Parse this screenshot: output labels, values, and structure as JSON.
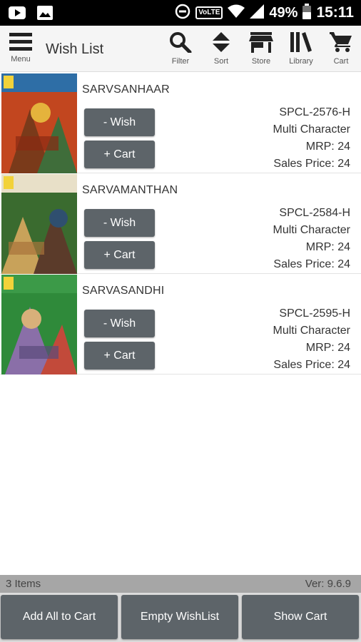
{
  "status_bar": {
    "volte_label": "VoLTE",
    "battery": "49%",
    "time": "15:11"
  },
  "toolbar": {
    "menu_label": "Menu",
    "title": "Wish List",
    "filter_label": "Filter",
    "sort_label": "Sort",
    "store_label": "Store",
    "library_label": "Library",
    "cart_label": "Cart"
  },
  "items": [
    {
      "title": "SARVSANHAAR",
      "wish_label": "- Wish",
      "cart_label": "+ Cart",
      "code": "SPCL-2576-H",
      "category": "Multi Character",
      "mrp": "MRP: 24",
      "sales_price": "Sales Price: 24",
      "cover_colors": [
        "#c2461f",
        "#7a3a1a",
        "#3f6d3a",
        "#e5b33c"
      ]
    },
    {
      "title": "SARVAMANTHAN",
      "wish_label": "- Wish",
      "cart_label": "+ Cart",
      "code": "SPCL-2584-H",
      "category": "Multi Character",
      "mrp": "MRP: 24",
      "sales_price": "Sales Price: 24",
      "cover_colors": [
        "#3a6b2f",
        "#c8a25a",
        "#5b3b2a",
        "#2f4f6f"
      ]
    },
    {
      "title": "SARVASANDHI",
      "wish_label": "- Wish",
      "cart_label": "+ Cart",
      "code": "SPCL-2595-H",
      "category": "Multi Character",
      "mrp": "MRP: 24",
      "sales_price": "Sales Price: 24",
      "cover_colors": [
        "#2f8a3a",
        "#8a6fa8",
        "#c24a3a",
        "#d8b07a"
      ]
    }
  ],
  "footer": {
    "items_count": "3 Items",
    "version": "Ver: 9.6.9",
    "add_all_label": "Add All to Cart",
    "empty_label": "Empty WishList",
    "show_cart_label": "Show Cart"
  },
  "colors": {
    "button_bg": "#5d6469",
    "status_bar_bg": "#000000",
    "toolbar_bg": "#f5f5f5"
  }
}
